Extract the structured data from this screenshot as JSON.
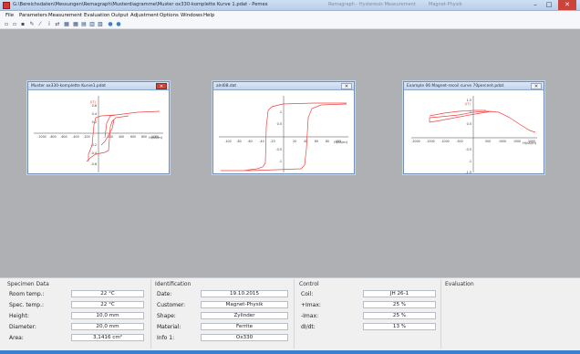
{
  "window": {
    "title": "G:\\Bereichsdaten\\Messungen\\Remagraph\\Musterdiagramme\\Muster ox330-komplette Kurve 1.pdat - Pemex",
    "ghost_text": [
      "Remagraph - Hysteresis Measurement",
      "Magnet-Physik"
    ],
    "controls": [
      "–",
      "□",
      "✕"
    ]
  },
  "menubar": [
    "File",
    "Parameters",
    "Measurement",
    "Evaluation",
    "Output",
    "Adjustment",
    "Options",
    "Windows",
    "Help"
  ],
  "toolbar": [
    {
      "icon": "new-file-icon",
      "glyph": "▫"
    },
    {
      "icon": "open-file-icon",
      "glyph": "▫"
    },
    {
      "icon": "save-icon",
      "glyph": "▪"
    },
    {
      "icon": "tools-icon",
      "glyph": "✎"
    },
    {
      "icon": "wand-icon",
      "glyph": "⁄"
    },
    {
      "icon": "info-icon",
      "glyph": "i"
    },
    {
      "icon": "measure-icon",
      "glyph": "⇄"
    },
    {
      "icon": "table-icon",
      "glyph": "▦"
    },
    {
      "icon": "grid-icon",
      "glyph": "▦"
    },
    {
      "icon": "chart-icon",
      "glyph": "▤"
    },
    {
      "icon": "list-icon",
      "glyph": "▥"
    },
    {
      "icon": "export-icon",
      "glyph": "▧"
    },
    {
      "icon": "globe-icon",
      "glyph": "●"
    },
    {
      "icon": "help-icon",
      "glyph": "●"
    }
  ],
  "colors": {
    "curve": "#ee4444",
    "workspace": "#aeb0b3",
    "accent": "#3a7fd0"
  },
  "charts": [
    {
      "title": "Muster ox330-komplette Kurve1.pdat",
      "close_style": "red",
      "close_glyph": "✕",
      "y_label": "J(T)",
      "x_label": "H(kA/m)",
      "y_ticks": [
        "0.6",
        "0.4",
        "0.2",
        "-0.2",
        "-0.4",
        "-0.6"
      ],
      "x_ticks": [
        "-1000",
        "-800",
        "-600",
        "-400",
        "-200",
        "200",
        "400",
        "600",
        "800",
        "1000"
      ]
    },
    {
      "title": "alnl08.dat",
      "close_style": "plain",
      "close_glyph": "✕",
      "y_label": "",
      "x_label": "H(kA/m)",
      "y_ticks": [
        "1",
        "0.5",
        "-0.5",
        "-1"
      ],
      "x_ticks": [
        "-100",
        "-80",
        "-60",
        "-40",
        "-20",
        "20",
        "40",
        "60",
        "80",
        "100"
      ]
    },
    {
      "title": "Example 06 Magnet-recoil curve 70percent.pdat",
      "close_style": "plain",
      "close_glyph": "✕",
      "y_label": "J(T)",
      "x_label": "H(kA/m)",
      "y_ticks": [
        "1.5",
        "1",
        "0.5",
        "-0.5",
        "-1",
        "-1.5"
      ],
      "x_ticks": [
        "-2000",
        "-1500",
        "-1000",
        "-500",
        "500",
        "1000",
        "1500",
        "2000"
      ]
    }
  ],
  "specimen": {
    "title": "Specimen Data",
    "rows": [
      {
        "label": "Room temp.:",
        "value": "22 °C"
      },
      {
        "label": "Spec. temp.:",
        "value": "22 °C"
      },
      {
        "label": "Height:",
        "value": "10,0 mm"
      },
      {
        "label": "Diameter:",
        "value": "20,0 mm"
      },
      {
        "label": "Area:",
        "value": "3,1416 cm²"
      }
    ]
  },
  "identification": {
    "title": "Identification",
    "rows": [
      {
        "label": "Date:",
        "value": "19.10.2015"
      },
      {
        "label": "Customer:",
        "value": "Magnet-Physik"
      },
      {
        "label": "Shape:",
        "value": "Zylinder"
      },
      {
        "label": "Material:",
        "value": "Ferrite"
      },
      {
        "label": "Info 1:",
        "value": "Ox330"
      }
    ]
  },
  "control": {
    "title": "Control",
    "rows": [
      {
        "label": "Coil:",
        "value": "JH 26-1"
      },
      {
        "label": "+Imax:",
        "value": "25 %"
      },
      {
        "label": "-Imax:",
        "value": "25 %"
      },
      {
        "label": "dI/dt:",
        "value": "13 %"
      }
    ]
  },
  "evaluation": {
    "title": "Evaluation"
  }
}
